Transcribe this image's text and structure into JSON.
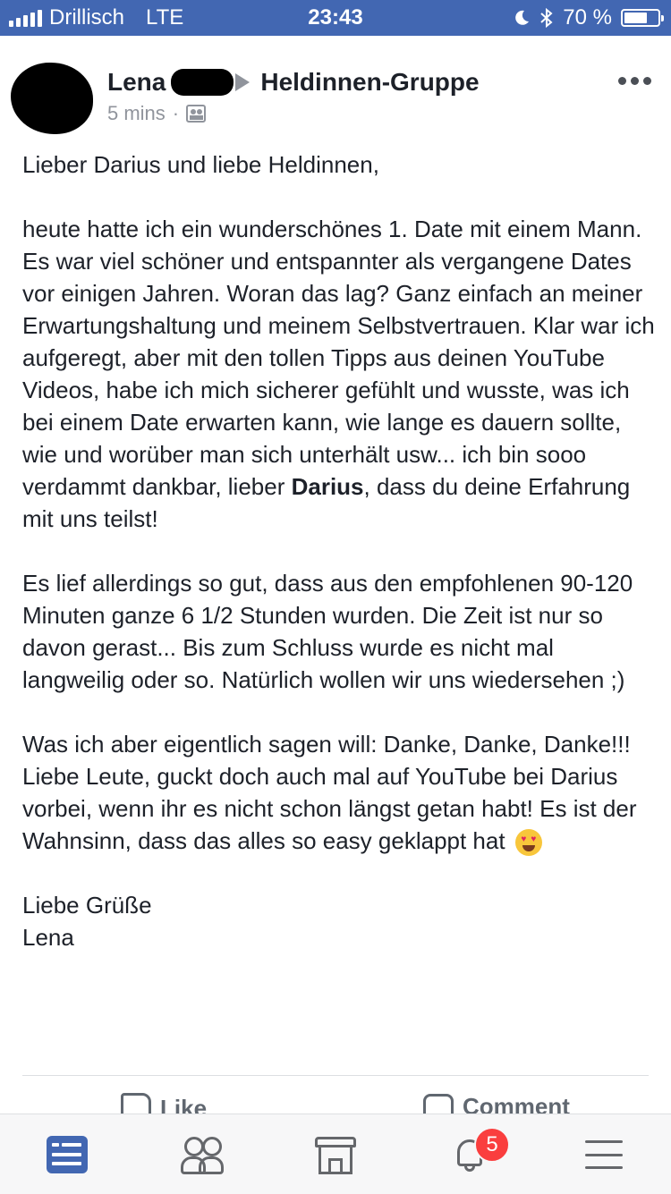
{
  "status_bar": {
    "carrier": "Drillisch",
    "network": "LTE",
    "time": "23:43",
    "battery": "70 %",
    "battery_level": 0.7,
    "moon_icon": "moon-icon",
    "bluetooth_icon": "bluetooth-icon"
  },
  "post": {
    "author": "Lena",
    "group": "Heldinnen-Gruppe",
    "time": "5 mins",
    "separator": "·",
    "greeting": "Lieber Darius und liebe Heldinnen,",
    "paragraph1_before": "heute hatte ich ein wunderschönes 1. Date mit einem Mann. Es war viel schöner und entspannter als vergangene Dates vor einigen Jahren. Woran das lag? Ganz einfach an meiner Erwartungshaltung und meinem Selbstvertrauen. Klar war ich aufgeregt, aber mit den tollen Tipps aus deinen YouTube Videos, habe ich mich sicherer gefühlt und wusste, was ich bei einem Date erwarten kann, wie lange es dauern sollte, wie und worüber man sich unterhält usw... ich bin sooo verdammt dankbar, lieber ",
    "paragraph1_bold": "Darius",
    "paragraph1_after": ", dass du deine Erfahrung mit uns teilst!",
    "paragraph2": "Es lief allerdings so gut, dass aus den empfohlenen 90-120 Minuten ganze 6 1/2 Stunden wurden. Die Zeit ist nur so davon gerast... Bis zum Schluss wurde es nicht mal langweilig oder so. Natürlich wollen wir uns wiedersehen ;)",
    "paragraph3": "Was ich aber eigentlich sagen will: Danke, Danke, Danke!!! Liebe Leute, guckt doch auch mal auf YouTube bei Darius vorbei, wenn ihr es nicht schon längst getan habt! Es ist der Wahnsinn, dass das alles so easy geklappt hat",
    "closing1": "Liebe Grüße",
    "closing2": "Lena"
  },
  "actions": {
    "like": "Like",
    "comment": "Comment"
  },
  "tab_bar": {
    "notifications_badge": "5",
    "accent_color": "#4267b2",
    "icons": [
      "news-feed-icon",
      "groups-icon",
      "marketplace-icon",
      "bell-icon",
      "menu-icon"
    ]
  }
}
